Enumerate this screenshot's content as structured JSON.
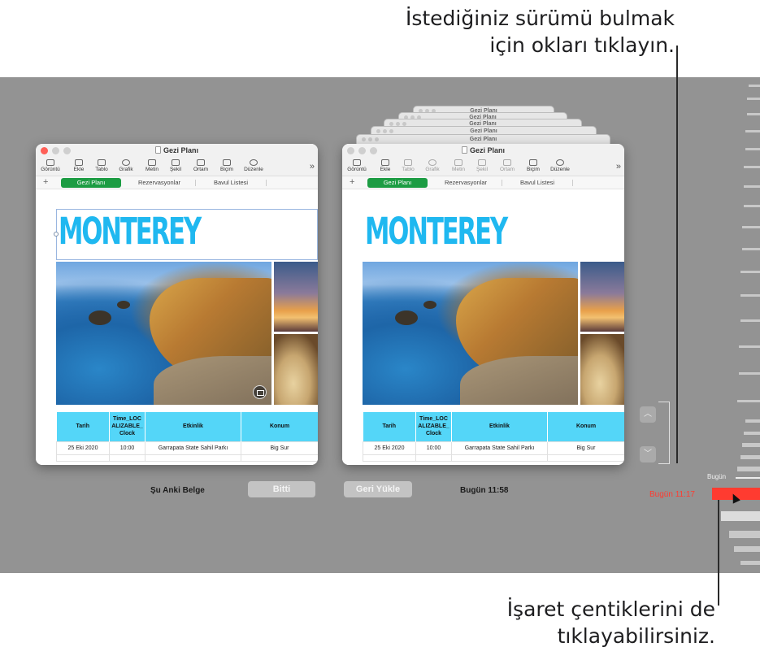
{
  "callouts": {
    "top_line1": "İstediğiniz sürümü bulmak",
    "top_line2": "için okları tıklayın.",
    "bottom_line1": "İşaret çentiklerini de",
    "bottom_line2": "tıklayabilirsiniz."
  },
  "window": {
    "title": "Gezi Planı",
    "toolbar": [
      "Görüntü",
      "Ekle",
      "Tablo",
      "Grafik",
      "Metin",
      "Şekil",
      "Ortam",
      "Biçim",
      "Düzenle"
    ],
    "more": "»",
    "add_sheet": "+",
    "tabs": [
      "Gezi Planı",
      "Rezervasyonlar",
      "Bavul Listesi"
    ],
    "heading": "MONTEREY",
    "table": {
      "headers": [
        "Tarih",
        "Time_LOCALIZABLE_Clock",
        "Etkinlik",
        "Konum"
      ],
      "rows": [
        [
          "25 Eki 2020",
          "10:00",
          "Garrapata State Sahil Parkı",
          "Big Sur"
        ]
      ]
    }
  },
  "stack_titles": [
    "Gezi Planı",
    "Gezi Planı",
    "Gezi Planı",
    "Gezi Planı",
    "Gezi Planı"
  ],
  "labels": {
    "current": "Şu Anki Belge",
    "done": "Bitti",
    "restore": "Geri Yükle",
    "version_time": "Bugün 11:58"
  },
  "nav": {
    "up": "︿",
    "down": "﹀"
  },
  "timeline": {
    "today": "Bugün",
    "current_time": "Bugün 11:17"
  },
  "colors": {
    "accent_red": "#ff3b30",
    "tab_green": "#1c9c43",
    "heading_blue": "#1fb8f0",
    "table_header": "#54d6f8",
    "backdrop": "#939393"
  }
}
